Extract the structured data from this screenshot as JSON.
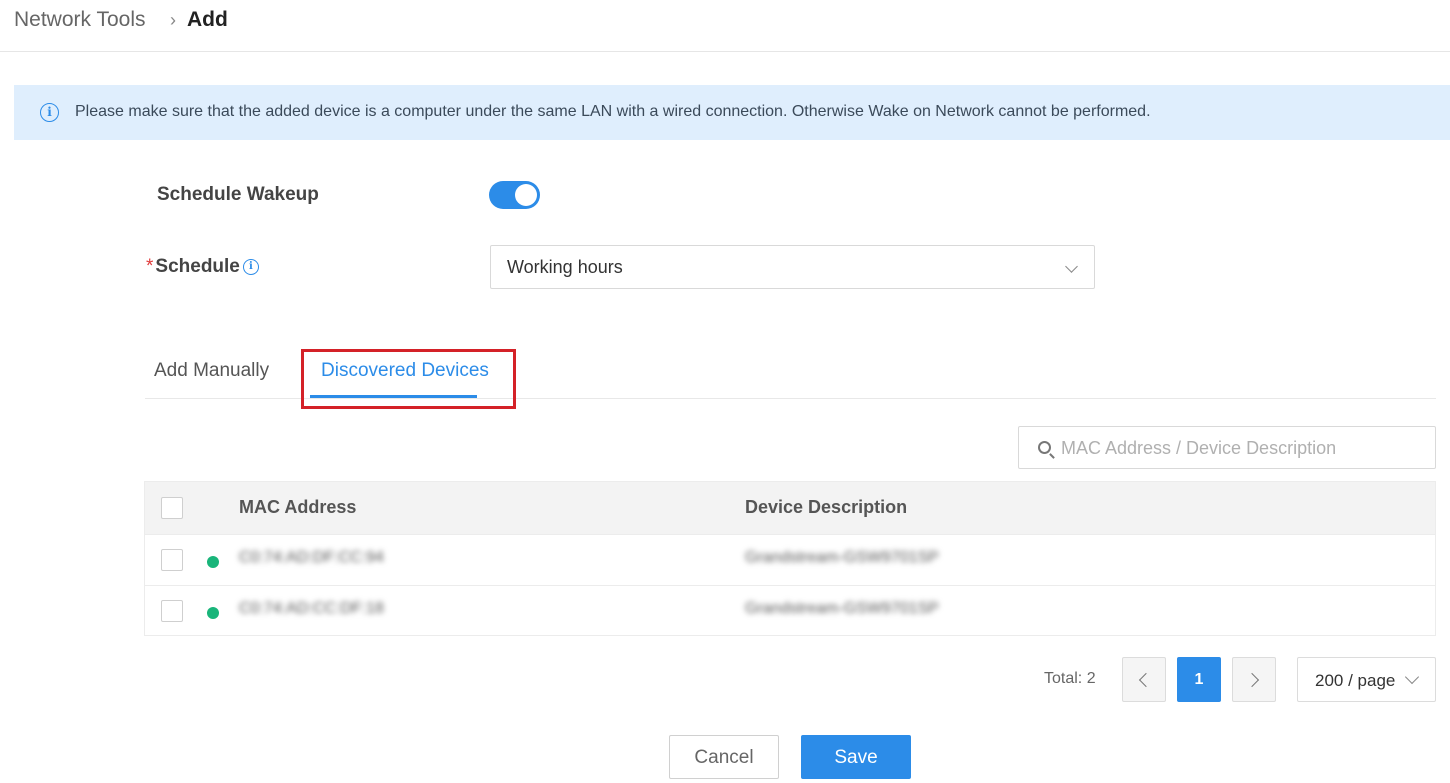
{
  "breadcrumb": {
    "parent": "Network Tools",
    "separator": "›",
    "current": "Add"
  },
  "notice": {
    "icon": "info-icon",
    "text": "Please make sure that the added device is a computer under the same LAN with a wired connection. Otherwise Wake on Network cannot be performed."
  },
  "form": {
    "schedule_wakeup_label": "Schedule Wakeup",
    "schedule_wakeup_enabled": true,
    "schedule_required_mark": "*",
    "schedule_label": "Schedule",
    "schedule_info_icon": "info-icon",
    "schedule_value": "Working hours"
  },
  "tabs": [
    {
      "label": "Add Manually",
      "active": false
    },
    {
      "label": "Discovered Devices",
      "active": true
    }
  ],
  "search": {
    "placeholder": "MAC Address / Device Description",
    "value": ""
  },
  "table": {
    "columns": [
      "MAC Address",
      "Device Description"
    ],
    "rows": [
      {
        "mac": "C0:74:AD:DF:CC:94",
        "description": "Grandstream-GSW9701SP",
        "status": "online"
      },
      {
        "mac": "C0:74:AD:CC:DF:18",
        "description": "Grandstream-GSW9701SP",
        "status": "online"
      }
    ]
  },
  "pagination": {
    "total_label": "Total: 2",
    "current_page": "1",
    "page_size": "200 / page"
  },
  "actions": {
    "cancel_label": "Cancel",
    "save_label": "Save"
  },
  "colors": {
    "accent": "#2c8ce8",
    "online": "#19b57a",
    "highlight": "#d42128",
    "notice_bg": "#dfeefd"
  }
}
